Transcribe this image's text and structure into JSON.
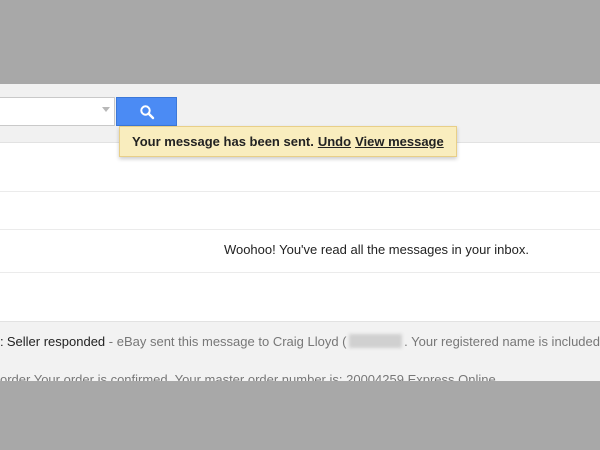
{
  "search": {
    "placeholder": "",
    "dropdown_icon": "triangle-down",
    "button_icon": "magnifier",
    "button_color": "#4b8bf4"
  },
  "notification": {
    "text": "Your message has been sent.",
    "undo_label": "Undo",
    "view_label": "View message",
    "background": "#f9edbe"
  },
  "inbox": {
    "empty_message": "Woohoo! You've read all the messages in your inbox."
  },
  "emails": [
    {
      "sender_fragment": ":",
      "subject": "Seller responded",
      "separator": " - ",
      "snippet_before": "eBay sent this message to Craig Lloyd (",
      "snippet_after": ". Your registered name is included"
    },
    {
      "snippet": "order Your order is confirmed. Your master order number is: 20004259 Express Online"
    }
  ]
}
